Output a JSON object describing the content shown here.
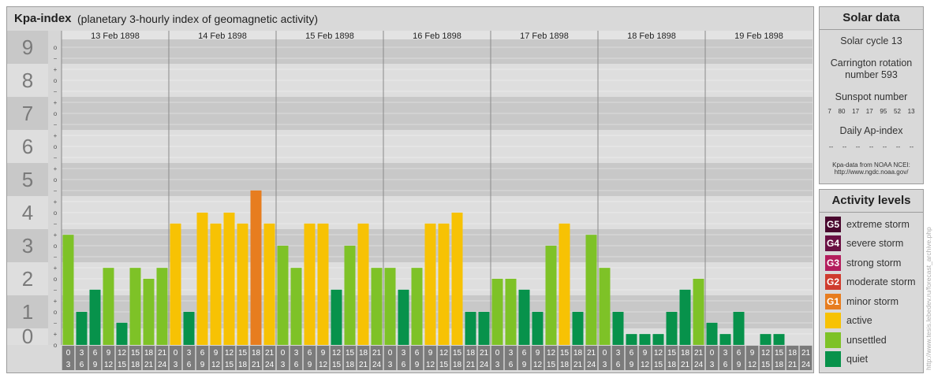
{
  "header": {
    "title": "Kpa-index",
    "subtitle": "(planetary 3-hourly index of geomagnetic activity)"
  },
  "chart_data": {
    "type": "bar",
    "y_ticks": [
      "0",
      "1",
      "2",
      "3",
      "4",
      "5",
      "6",
      "7",
      "8",
      "9"
    ],
    "ylim": [
      0,
      9
    ],
    "sub_tick_labels": [
      "o",
      "+",
      "−"
    ],
    "days": [
      "13 Feb 1898",
      "14 Feb 1898",
      "15 Feb 1898",
      "16 Feb 1898",
      "17 Feb 1898",
      "18 Feb 1898",
      "19 Feb 1898"
    ],
    "hour_labels": [
      [
        "0",
        "3"
      ],
      [
        "3",
        "6"
      ],
      [
        "6",
        "9"
      ],
      [
        "9",
        "12"
      ],
      [
        "12",
        "15"
      ],
      [
        "15",
        "18"
      ],
      [
        "18",
        "21"
      ],
      [
        "21",
        "24"
      ]
    ],
    "series": [
      {
        "values": [
          3.33,
          1.0,
          1.67,
          2.33,
          0.67,
          2.33,
          2.0,
          2.33
        ]
      },
      {
        "values": [
          3.67,
          1.0,
          4.0,
          3.67,
          4.0,
          3.67,
          4.67,
          3.67
        ]
      },
      {
        "values": [
          3.0,
          2.33,
          3.67,
          3.67,
          1.67,
          3.0,
          3.67,
          2.33
        ]
      },
      {
        "values": [
          2.33,
          1.67,
          2.33,
          3.67,
          3.67,
          4.0,
          1.0,
          1.0
        ]
      },
      {
        "values": [
          2.0,
          2.0,
          1.67,
          1.0,
          3.0,
          3.67,
          1.0,
          3.33
        ]
      },
      {
        "values": [
          2.33,
          1.0,
          0.33,
          0.33,
          0.33,
          1.0,
          1.67,
          2.0
        ]
      },
      {
        "values": [
          0.67,
          0.33,
          1.0,
          0.0,
          0.33,
          0.33,
          0.0,
          -0.33
        ]
      }
    ],
    "levels": [
      {
        "max": 1.67,
        "color": "#07924b"
      },
      {
        "max": 3.33,
        "color": "#7ec227"
      },
      {
        "max": 4.33,
        "color": "#f7c204"
      },
      {
        "max": 5.33,
        "color": "#e77d1f"
      },
      {
        "max": 6.33,
        "color": "#cf3c2e"
      },
      {
        "max": 7.33,
        "color": "#b41e5d"
      },
      {
        "max": 8.33,
        "color": "#6a1043"
      },
      {
        "max": 9.5,
        "color": "#49082e"
      }
    ]
  },
  "solar": {
    "title": "Solar data",
    "cycle": "Solar cycle 13",
    "carrington_line1": "Carrington rotation",
    "carrington_line2": "number 593",
    "sunspot_title": "Sunspot number",
    "sunspot_values": [
      "7",
      "80",
      "17",
      "17",
      "95",
      "52",
      "13"
    ],
    "ap_title": "Daily Ap-index",
    "ap_values": [
      "--",
      "--",
      "--",
      "--",
      "--",
      "--",
      "--"
    ],
    "source_line1": "Kpa-data from NOAA NCEI:",
    "source_line2": "http://www.ngdc.noaa.gov/"
  },
  "activity": {
    "title": "Activity levels",
    "items": [
      {
        "badge": "G5",
        "label": "extreme storm",
        "color": "#49082e"
      },
      {
        "badge": "G4",
        "label": "severe storm",
        "color": "#6a1043"
      },
      {
        "badge": "G3",
        "label": "strong storm",
        "color": "#b41e5d"
      },
      {
        "badge": "G2",
        "label": "moderate storm",
        "color": "#cf3c2e"
      },
      {
        "badge": "G1",
        "label": "minor storm",
        "color": "#e77d1f"
      },
      {
        "badge": "",
        "label": "active",
        "color": "#f7c204"
      },
      {
        "badge": "",
        "label": "unsettled",
        "color": "#7ec227"
      },
      {
        "badge": "",
        "label": "quiet",
        "color": "#07924b"
      }
    ]
  },
  "watermark": "http://www.tesis.lebedev.ru/forecast_archive.php"
}
